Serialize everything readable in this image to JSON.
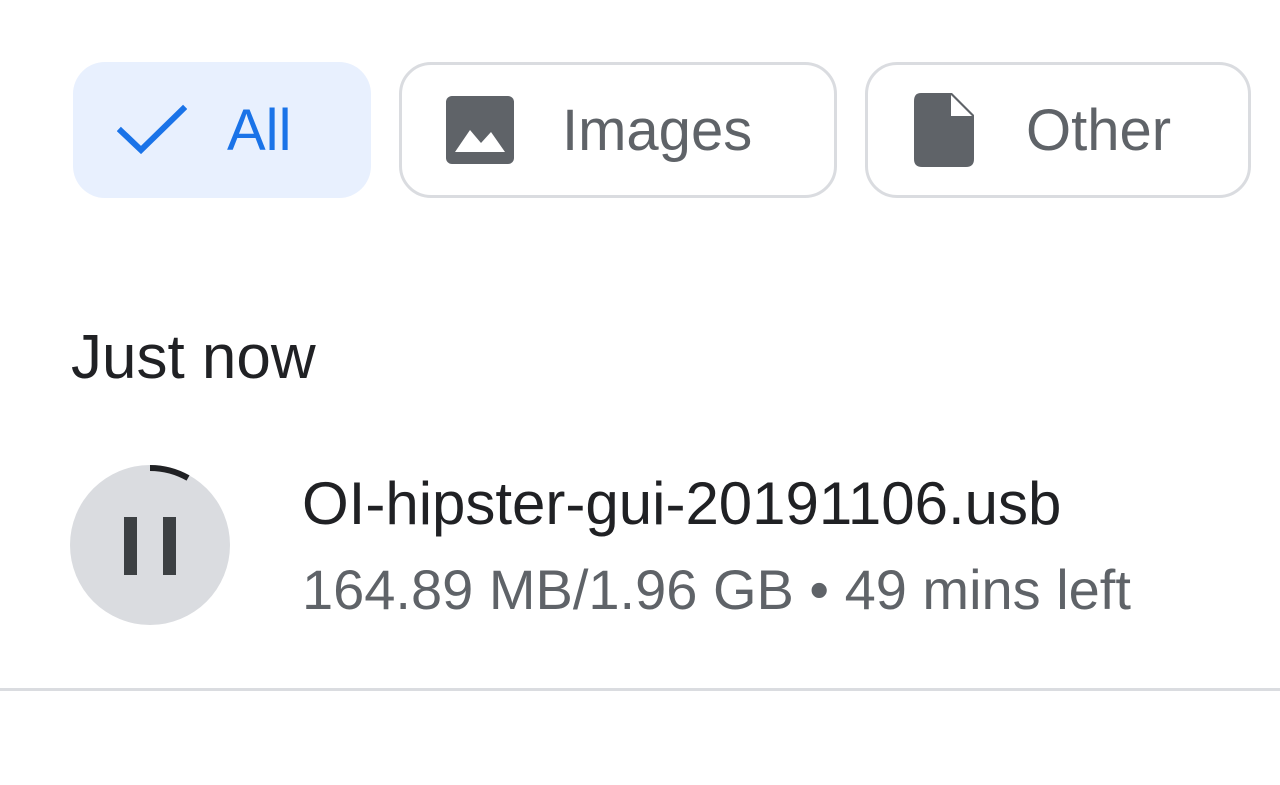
{
  "filters": {
    "all": {
      "label": "All",
      "icon": "check-icon",
      "selected": true
    },
    "images": {
      "label": "Images",
      "icon": "image-icon"
    },
    "other": {
      "label": "Other",
      "icon": "file-icon"
    }
  },
  "section": {
    "header": "Just now"
  },
  "download": {
    "file_name": "OI-hipster-gui-20191106.usb",
    "status": "164.89 MB/1.96 GB • 49 mins left",
    "state_icon": "pause-icon",
    "progress": 0.0822
  },
  "colors": {
    "accent": "#1a73e8",
    "selected_chip_bg": "#e8f0fe",
    "secondary_text": "#5f6368",
    "primary_text": "#202124",
    "border": "#dadce0",
    "progress_track": "#dadce0",
    "progress_fill": "#202124"
  }
}
